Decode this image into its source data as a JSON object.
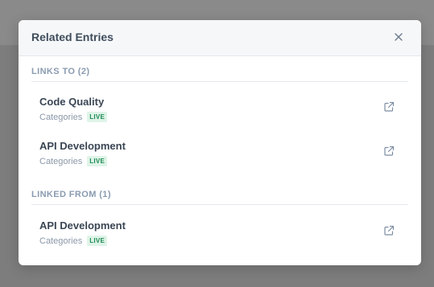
{
  "modal": {
    "title": "Related Entries"
  },
  "links_to": {
    "heading": "LINKS TO (2)",
    "entries": [
      {
        "title": "Code Quality",
        "section": "Categories",
        "status": "LIVE"
      },
      {
        "title": "API Development",
        "section": "Categories",
        "status": "LIVE"
      }
    ]
  },
  "linked_from": {
    "heading": "LINKED FROM (1)",
    "entries": [
      {
        "title": "API Development",
        "section": "Categories",
        "status": "LIVE"
      }
    ]
  },
  "icons": {
    "close": "close-icon",
    "external": "external-link-icon"
  },
  "colors": {
    "status_live_text": "#1f8a55",
    "status_live_bg": "#dff4e8"
  }
}
